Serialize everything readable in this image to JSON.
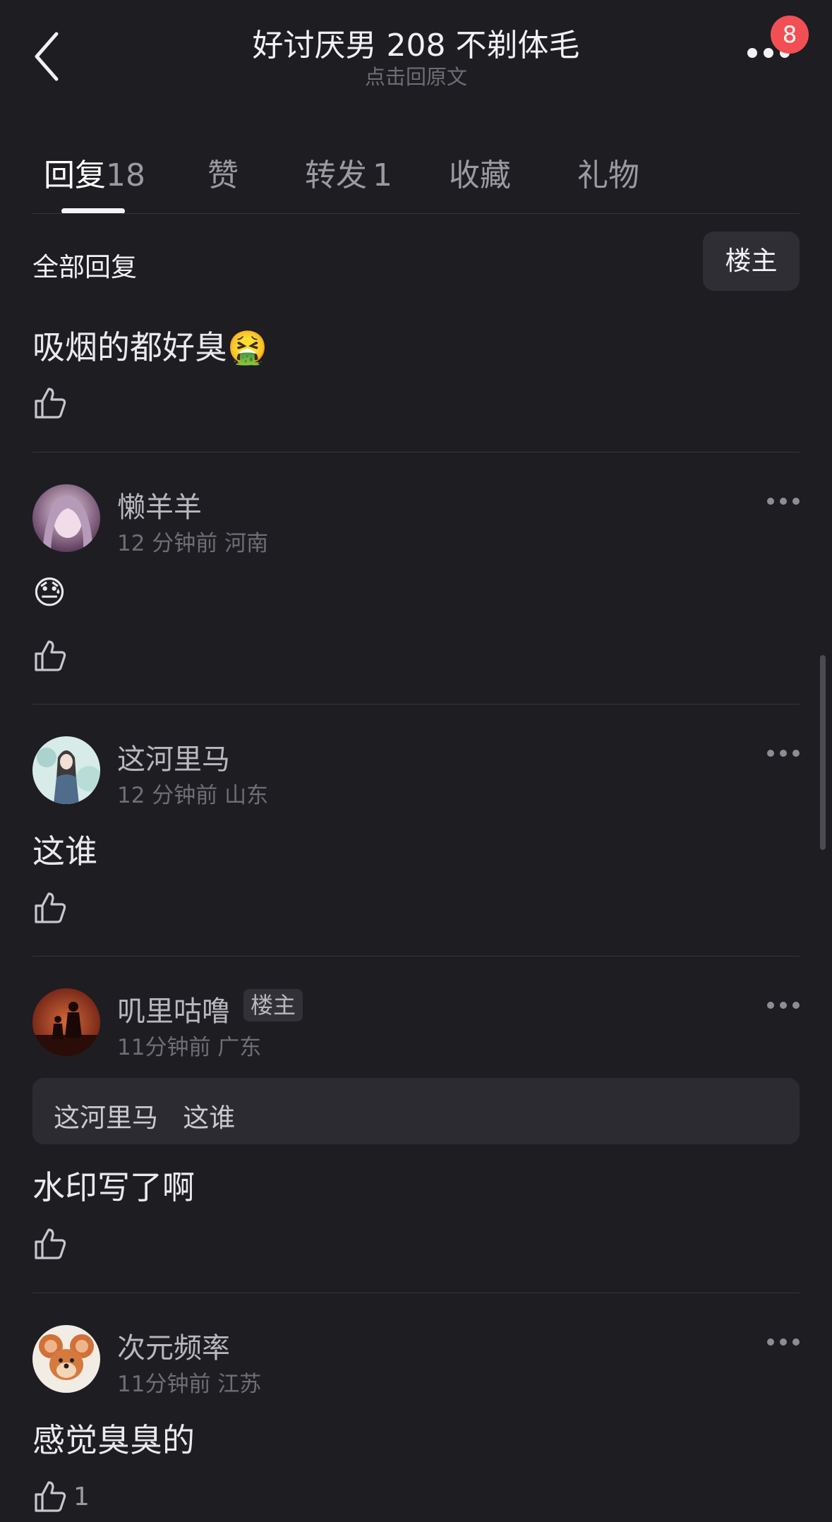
{
  "header": {
    "title": "好讨厌男 208 不剃体毛",
    "subtitle": "点击回原文",
    "notification_count": "8"
  },
  "tabs": [
    {
      "label": "回复",
      "count": "18",
      "active": true
    },
    {
      "label": "赞",
      "count": ""
    },
    {
      "label": "转发",
      "count": "1"
    },
    {
      "label": "收藏",
      "count": ""
    },
    {
      "label": "礼物",
      "count": ""
    }
  ],
  "section": {
    "title": "全部回复",
    "filter_button": "楼主"
  },
  "comments": [
    {
      "text": "吸烟的都好臭🤮",
      "likes": ""
    },
    {
      "username": "懒羊羊",
      "meta": "12 分钟前  河南",
      "text": "😓",
      "likes": "",
      "avatar": "anime-girl-avatar"
    },
    {
      "username": "这河里马",
      "meta": "12 分钟前  山东",
      "text": "这谁",
      "likes": "",
      "avatar": "girl-illustration-avatar"
    },
    {
      "username": "叽里咕噜",
      "owner_tag": "楼主",
      "meta": "11分钟前  广东",
      "quote": "这河里马   这谁",
      "text": "水印写了啊",
      "likes": "",
      "avatar": "silhouette-sunset-avatar"
    },
    {
      "username": "次元频率",
      "meta": "11分钟前  江苏",
      "text": "感觉臭臭的",
      "likes": "1",
      "avatar": "cartoon-mouse-avatar"
    }
  ],
  "colors": {
    "background": "#1d1d22",
    "badge": "#f24f55",
    "primary_text": "#e9e9ee",
    "secondary_text": "#6e6e75"
  }
}
